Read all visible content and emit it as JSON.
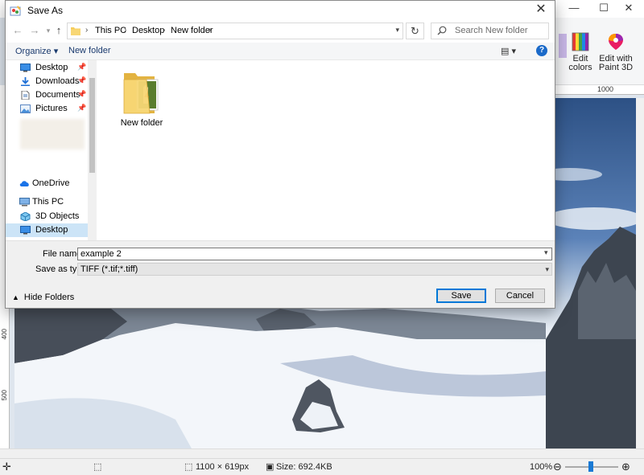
{
  "paint": {
    "ribbon": [
      {
        "label_1": "Edit",
        "label_2": "colors"
      },
      {
        "label_1": "Edit with",
        "label_2": "Paint 3D"
      }
    ],
    "ruler_top": [
      "1000"
    ],
    "ruler_left": [
      "400",
      "500"
    ],
    "status": {
      "dimensions": "1100 × 619px",
      "size": "Size: 692.4KB",
      "zoom": "100%"
    }
  },
  "dialog": {
    "title": "Save As",
    "breadcrumb": [
      "This PC",
      "Desktop",
      "New folder"
    ],
    "search_placeholder": "Search New folder",
    "toolbar": {
      "organize_label": "Organize ▾",
      "new_folder_label": "New folder"
    },
    "nav_items": [
      {
        "label": "Desktop",
        "icon": "desktop-icon",
        "pinned": true
      },
      {
        "label": "Downloads",
        "icon": "download-icon",
        "pinned": true
      },
      {
        "label": "Documents",
        "icon": "documents-icon",
        "pinned": true
      },
      {
        "label": "Pictures",
        "icon": "pictures-icon",
        "pinned": true
      },
      {
        "label": "OneDrive",
        "icon": "cloud-icon",
        "pinned": false
      },
      {
        "label": "This PC",
        "icon": "computer-icon",
        "pinned": false
      },
      {
        "label": "3D Objects",
        "icon": "cube-icon",
        "pinned": false
      },
      {
        "label": "Desktop",
        "icon": "desktop-icon",
        "pinned": false,
        "selected": true
      }
    ],
    "files": [
      {
        "name": "New folder",
        "icon": "folder-icon"
      }
    ],
    "file_name_label": "File name:",
    "file_name_value": "example 2",
    "save_type_label": "Save as type:",
    "save_type_value": "TIFF (*.tif;*.tiff)",
    "hide_folders_label": "Hide Folders",
    "save_label": "Save",
    "cancel_label": "Cancel"
  },
  "colors": {
    "accent": "#0078d7",
    "selected": "#cce4f7",
    "folder": "#f6cc5b"
  }
}
